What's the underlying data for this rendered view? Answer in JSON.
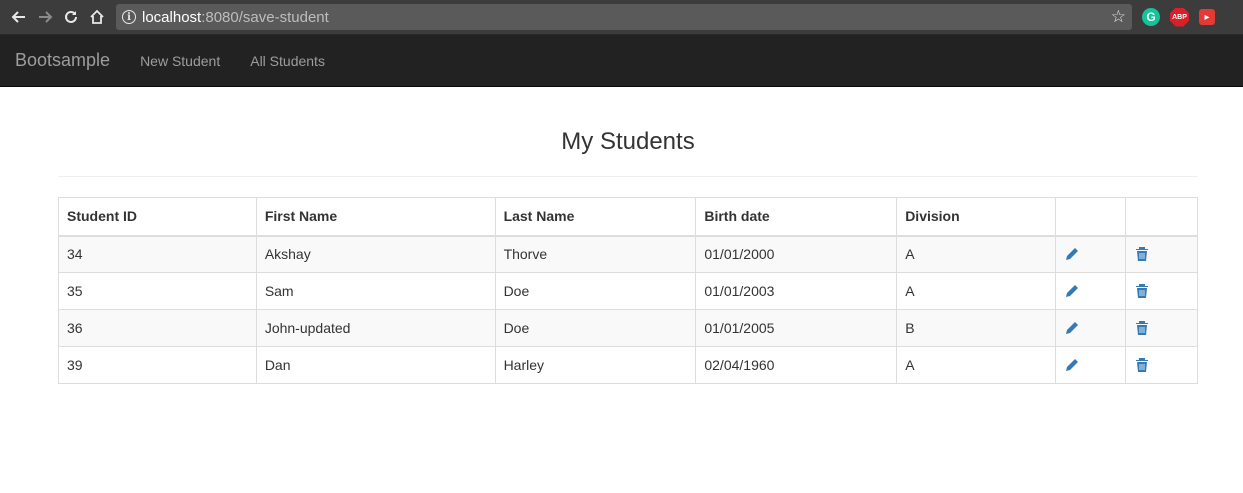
{
  "browser": {
    "url_host": "localhost",
    "url_rest": ":8080/save-student"
  },
  "navbar": {
    "brand": "Bootsample",
    "links": [
      "New Student",
      "All Students"
    ]
  },
  "main": {
    "title": "My Students",
    "table": {
      "headers": [
        "Student ID",
        "First Name",
        "Last Name",
        "Birth date",
        "Division",
        "",
        ""
      ],
      "rows": [
        {
          "id": "34",
          "first": "Akshay",
          "last": "Thorve",
          "birth": "01/01/2000",
          "division": "A"
        },
        {
          "id": "35",
          "first": "Sam",
          "last": "Doe",
          "birth": "01/01/2003",
          "division": "A"
        },
        {
          "id": "36",
          "first": "John-updated",
          "last": "Doe",
          "birth": "01/01/2005",
          "division": "B"
        },
        {
          "id": "39",
          "first": "Dan",
          "last": "Harley",
          "birth": "02/04/1960",
          "division": "A"
        }
      ]
    }
  },
  "icons": {
    "edit": "pencil-icon",
    "delete": "trash-icon"
  },
  "colors": {
    "navbar_bg": "#222222",
    "navbar_text": "#9d9d9d",
    "icon_blue": "#337ab7",
    "stripe": "#f9f9f9"
  }
}
